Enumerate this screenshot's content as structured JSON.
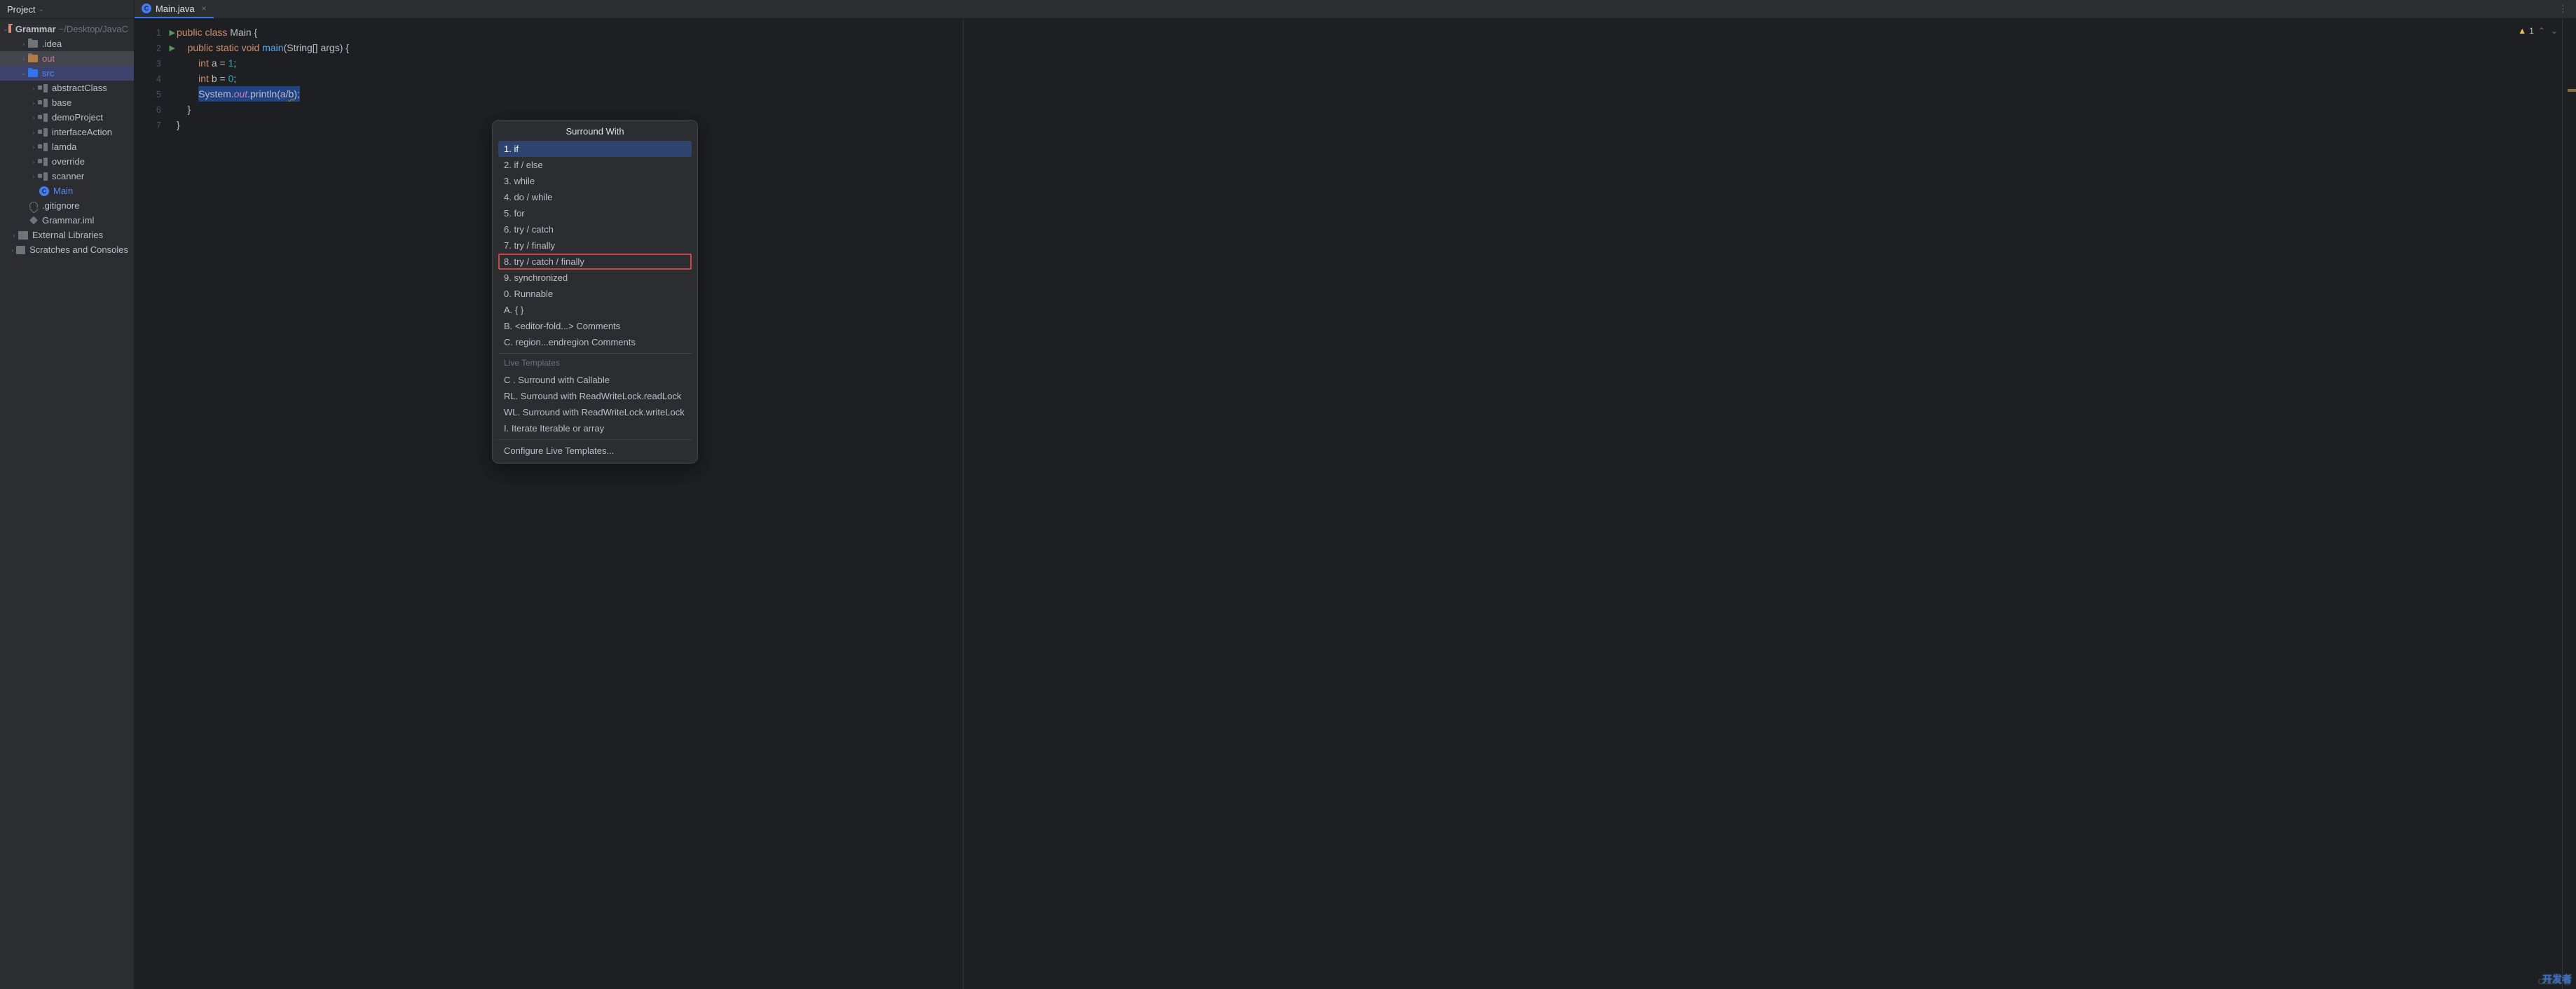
{
  "project": {
    "label": "Project",
    "root": "Grammar",
    "path": "~/Desktop/JavaC"
  },
  "tree": {
    "idea": ".idea",
    "out": "out",
    "src": "src",
    "pkgs": [
      "abstractClass",
      "base",
      "demoProject",
      "interfaceAction",
      "lamda",
      "override",
      "scanner"
    ],
    "main": "Main",
    "gitignore": ".gitignore",
    "iml": "Grammar.iml",
    "ext": "External Libraries",
    "scratch": "Scratches and Consoles"
  },
  "tab": {
    "name": "Main.java"
  },
  "code": {
    "l1": {
      "kw1": "public",
      "kw2": "class",
      "cls": "Main",
      "b": " {"
    },
    "l2": {
      "kw1": "public",
      "kw2": "static",
      "kw3": "void",
      "mth": "main",
      "sig": "(String[] args) {"
    },
    "l3": {
      "kw": "int",
      "v": "a = ",
      "lit": "1",
      "e": ";"
    },
    "l4": {
      "kw": "int",
      "v": "b = ",
      "lit": "0",
      "e": ";"
    },
    "l5": {
      "a": "System.",
      "fld": "out",
      "b": ".println(a/",
      "u": "b",
      "c": ");"
    },
    "l6": "    }",
    "l7": "}"
  },
  "gutter": [
    "1",
    "2",
    "3",
    "4",
    "5",
    "6",
    "7"
  ],
  "warning": {
    "count": "1"
  },
  "popup": {
    "title": "Surround With",
    "items": [
      "1. if",
      "2. if / else",
      "3. while",
      "4. do / while",
      "5. for",
      "6. try / catch",
      "7. try / finally",
      "8. try / catch / finally",
      "9. synchronized",
      "0. Runnable",
      "A. { }",
      "B. <editor-fold...> Comments",
      "C. region...endregion Comments"
    ],
    "live_section": "Live Templates",
    "live": [
      "C . Surround with Callable",
      "RL. Surround with ReadWriteLock.readLock",
      "WL. Surround with ReadWriteLock.writeLock",
      "I. Iterate Iterable or array"
    ],
    "configure": "Configure Live Templates..."
  },
  "watermark": "CSDN @",
  "wm2": "开发者"
}
